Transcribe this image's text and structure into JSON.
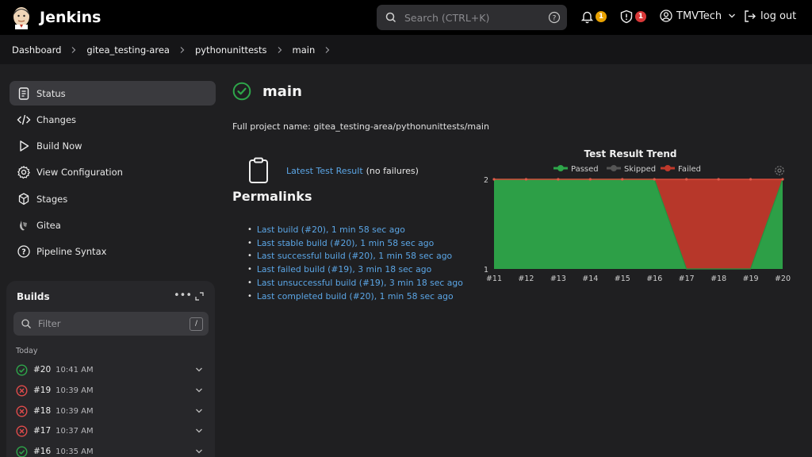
{
  "app": {
    "brand": "Jenkins"
  },
  "header": {
    "search_placeholder": "Search (CTRL+K)",
    "notifications_count": "1",
    "security_count": "1",
    "user": "TMVTech",
    "logout": "log out"
  },
  "breadcrumb": [
    "Dashboard",
    "gitea_testing-area",
    "pythonunittests",
    "main"
  ],
  "sidebar": {
    "tasks": [
      {
        "label": "Status",
        "icon": "status-icon"
      },
      {
        "label": "Changes",
        "icon": "code-icon"
      },
      {
        "label": "Build Now",
        "icon": "play-icon"
      },
      {
        "label": "View Configuration",
        "icon": "gear-icon"
      },
      {
        "label": "Stages",
        "icon": "stages-icon"
      },
      {
        "label": "Gitea",
        "icon": "gitea-icon"
      },
      {
        "label": "Pipeline Syntax",
        "icon": "help-icon"
      }
    ],
    "builds": {
      "title": "Builds",
      "filter_placeholder": "Filter",
      "filter_shortcut": "/",
      "group": "Today",
      "items": [
        {
          "number": "#20",
          "time": "10:41 AM",
          "status": "success"
        },
        {
          "number": "#19",
          "time": "10:39 AM",
          "status": "failed"
        },
        {
          "number": "#18",
          "time": "10:39 AM",
          "status": "failed"
        },
        {
          "number": "#17",
          "time": "10:37 AM",
          "status": "failed"
        },
        {
          "number": "#16",
          "time": "10:35 AM",
          "status": "success"
        }
      ]
    }
  },
  "main": {
    "title": "main",
    "full_name": "Full project name: gitea_testing-area/pythonunittests/main",
    "latest_test_result": "Latest Test Result",
    "no_failures": "(no failures)",
    "permalinks_title": "Permalinks",
    "permalinks": [
      "Last build (#20), 1 min 58 sec ago",
      "Last stable build (#20), 1 min 58 sec ago",
      "Last successful build (#20), 1 min 58 sec ago",
      "Last failed build (#19), 3 min 18 sec ago",
      "Last unsuccessful build (#19), 3 min 18 sec ago",
      "Last completed build (#20), 1 min 58 sec ago"
    ]
  },
  "colors": {
    "passed": "#2ea64a",
    "skipped": "#555555",
    "failed": "#c0392b",
    "link": "#5ba6e6"
  },
  "chart_data": {
    "type": "area",
    "title": "Test Result Trend",
    "categories": [
      "#11",
      "#12",
      "#13",
      "#14",
      "#15",
      "#16",
      "#17",
      "#18",
      "#19",
      "#20"
    ],
    "series": [
      {
        "name": "Passed",
        "values": [
          2,
          2,
          2,
          2,
          2,
          2,
          1,
          1,
          1,
          2
        ]
      },
      {
        "name": "Skipped",
        "values": [
          0,
          0,
          0,
          0,
          0,
          0,
          0,
          0,
          0,
          0
        ]
      },
      {
        "name": "Failed",
        "values": [
          0,
          0,
          0,
          0,
          0,
          0,
          1,
          1,
          1,
          0
        ]
      }
    ],
    "ylim": [
      1,
      2
    ],
    "yticks": [
      "1",
      "2"
    ],
    "legend": "top-center"
  }
}
